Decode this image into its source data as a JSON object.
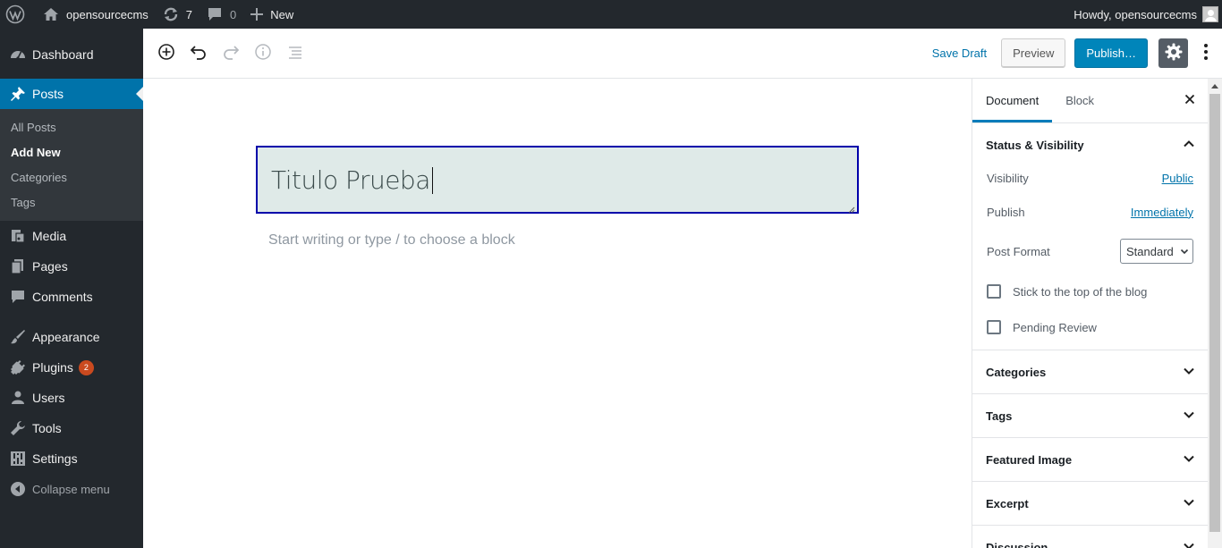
{
  "adminbar": {
    "site_name": "opensourcecms",
    "updates_count": "7",
    "comments_count": "0",
    "new_label": "New",
    "howdy": "Howdy, opensourcecms"
  },
  "menu": {
    "dashboard": "Dashboard",
    "posts": "Posts",
    "posts_sub": [
      "All Posts",
      "Add New",
      "Categories",
      "Tags"
    ],
    "media": "Media",
    "pages": "Pages",
    "comments": "Comments",
    "appearance": "Appearance",
    "plugins": "Plugins",
    "plugins_badge": "2",
    "users": "Users",
    "tools": "Tools",
    "settings": "Settings",
    "collapse": "Collapse menu"
  },
  "toolbar": {
    "save_draft": "Save Draft",
    "preview": "Preview",
    "publish": "Publish…"
  },
  "editor": {
    "title_value": "Titulo Prueba",
    "placeholder": "Start writing or type / to choose a block"
  },
  "sidebar": {
    "tabs": [
      "Document",
      "Block"
    ],
    "status_panel_title": "Status & Visibility",
    "visibility_label": "Visibility",
    "visibility_value": "Public",
    "publish_label": "Publish",
    "publish_value": "Immediately",
    "post_format_label": "Post Format",
    "post_format_value": "Standard",
    "sticky_label": "Stick to the top of the blog",
    "pending_label": "Pending Review",
    "panels": [
      "Categories",
      "Tags",
      "Featured Image",
      "Excerpt",
      "Discussion"
    ]
  },
  "colors": {
    "admin_dark": "#23282d",
    "accent": "#0073aa",
    "publish_button": "#0085ba",
    "badge": "#ca4a1f",
    "title_focus_border": "#0000aa"
  }
}
